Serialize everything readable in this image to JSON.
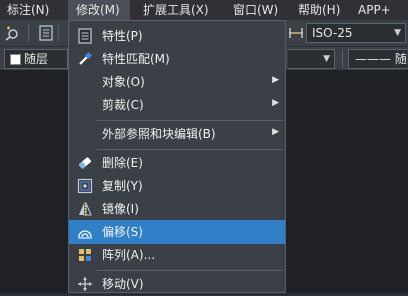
{
  "menubar": {
    "items": [
      {
        "label": "标注(N)"
      },
      {
        "label": "修改(M)"
      },
      {
        "label": "扩展工具(X)"
      },
      {
        "label": "窗口(W)"
      },
      {
        "label": "帮助(H)"
      },
      {
        "label": "APP+"
      }
    ]
  },
  "toolbar": {
    "dim_style": "ISO-25",
    "layer_value": "随层",
    "linetype_value": "——— 随层"
  },
  "menu": {
    "items": [
      {
        "label": "特性(P)",
        "icon": "properties-icon"
      },
      {
        "label": "特性匹配(M)",
        "icon": "match-properties-brush-icon"
      },
      {
        "label": "对象(O)",
        "submenu": true
      },
      {
        "label": "剪裁(C)",
        "submenu": true
      },
      {
        "label": "外部参照和块编辑(B)",
        "submenu": true
      },
      {
        "label": "删除(E)",
        "icon": "eraser-icon"
      },
      {
        "label": "复制(Y)",
        "icon": "copy-icon"
      },
      {
        "label": "镜像(I)",
        "icon": "mirror-icon"
      },
      {
        "label": "偏移(S)",
        "icon": "offset-icon",
        "highlighted": true
      },
      {
        "label": "阵列(A)...",
        "icon": "array-icon"
      },
      {
        "label": "移动(V)",
        "icon": "move-icon"
      }
    ]
  },
  "colors": {
    "highlight": "#2f80c9",
    "menu_bg": "#3b3f46",
    "menubar_bg": "#2f3136"
  }
}
